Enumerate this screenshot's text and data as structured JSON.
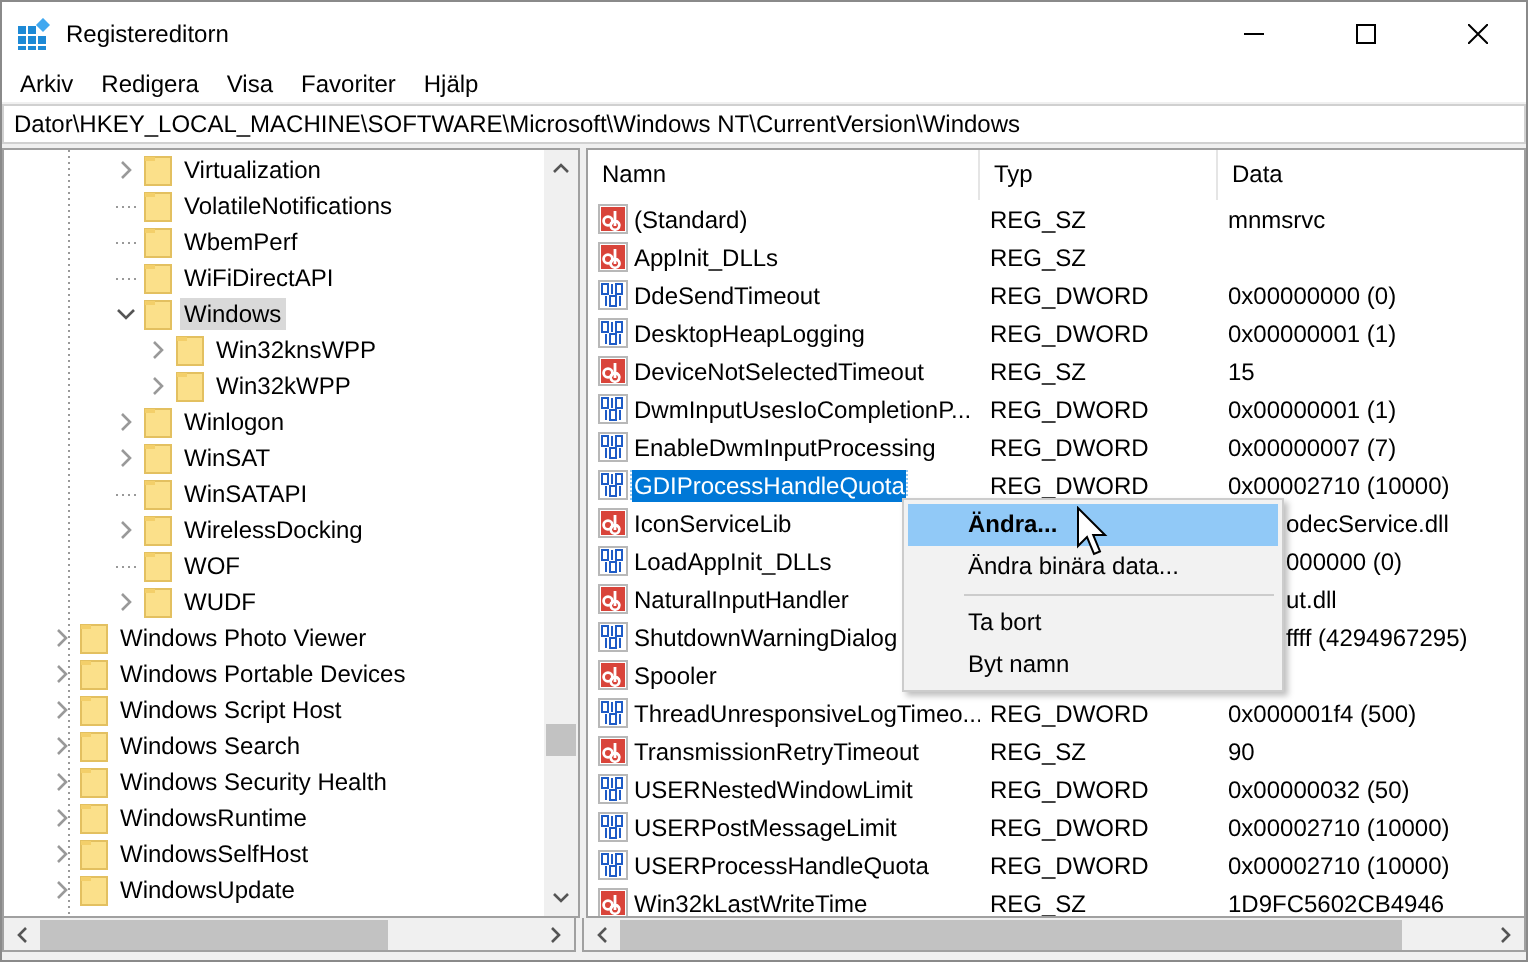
{
  "window": {
    "title": "Registereditorn"
  },
  "menu_bar": [
    "Arkiv",
    "Redigera",
    "Visa",
    "Favoriter",
    "Hjälp"
  ],
  "address": "Dator\\HKEY_LOCAL_MACHINE\\SOFTWARE\\Microsoft\\Windows NT\\CurrentVersion\\Windows",
  "tree": {
    "items": [
      {
        "children": [
          {
            "children": [
              {
                "label": "Virtualization",
                "expanded": false,
                "selected": false
              },
              {
                "label": "VolatileNotifications",
                "selected": false
              },
              {
                "label": "WbemPerf",
                "selected": false
              },
              {
                "label": "WiFiDirectAPI",
                "selected": false
              },
              {
                "label": "Windows",
                "expanded": true,
                "selected": true,
                "children": [
                  {
                    "label": "Win32knsWPP",
                    "expanded": false,
                    "selected": false
                  },
                  {
                    "label": "Win32kWPP",
                    "expanded": false,
                    "selected": false
                  }
                ]
              },
              {
                "label": "Winlogon",
                "expanded": false,
                "selected": false
              },
              {
                "label": "WinSAT",
                "expanded": false,
                "selected": false
              },
              {
                "label": "WinSATAPI",
                "selected": false
              },
              {
                "label": "WirelessDocking",
                "expanded": false,
                "selected": false
              },
              {
                "label": "WOF",
                "selected": false
              },
              {
                "label": "WUDF",
                "expanded": false,
                "selected": false
              }
            ]
          }
        ]
      },
      {
        "label": "Windows Photo Viewer",
        "expanded": false,
        "selected": false
      },
      {
        "label": "Windows Portable Devices",
        "expanded": false,
        "selected": false
      },
      {
        "label": "Windows Script Host",
        "expanded": false,
        "selected": false
      },
      {
        "label": "Windows Search",
        "expanded": false,
        "selected": false
      },
      {
        "label": "Windows Security Health",
        "expanded": false,
        "selected": false
      },
      {
        "label": "WindowsRuntime",
        "expanded": false,
        "selected": false
      },
      {
        "label": "WindowsSelfHost",
        "expanded": false,
        "selected": false
      },
      {
        "label": "WindowsUpdate",
        "expanded": false,
        "selected": false
      }
    ]
  },
  "table": {
    "columns": [
      "Namn",
      "Typ",
      "Data"
    ],
    "rows": [
      {
        "kind": "string",
        "name": "(Standard)",
        "type": "REG_SZ",
        "data": "mnmsrvc",
        "selected": false
      },
      {
        "kind": "string",
        "name": "AppInit_DLLs",
        "type": "REG_SZ",
        "selected": false
      },
      {
        "kind": "dword",
        "name": "DdeSendTimeout",
        "type": "REG_DWORD",
        "data": "0x00000000 (0)",
        "selected": false
      },
      {
        "kind": "dword",
        "name": "DesktopHeapLogging",
        "type": "REG_DWORD",
        "data": "0x00000001 (1)",
        "selected": false
      },
      {
        "kind": "string",
        "name": "DeviceNotSelectedTimeout",
        "type": "REG_SZ",
        "data": "15",
        "selected": false
      },
      {
        "kind": "dword",
        "name": "DwmInputUsesIoCompletionP...",
        "type": "REG_DWORD",
        "data": "0x00000001 (1)",
        "selected": false
      },
      {
        "kind": "dword",
        "name": "EnableDwmInputProcessing",
        "type": "REG_DWORD",
        "data": "0x00000007 (7)",
        "selected": false
      },
      {
        "kind": "dword",
        "name": "GDIProcessHandleQuota",
        "type": "REG_DWORD",
        "data": "0x00002710 (10000)",
        "selected": true
      },
      {
        "kind": "string",
        "name": "IconServiceLib",
        "data": "odecService.dll",
        "selected": false
      },
      {
        "kind": "dword",
        "name": "LoadAppInit_DLLs",
        "data": "000000 (0)",
        "selected": false
      },
      {
        "kind": "string",
        "name": "NaturalInputHandler",
        "data": "ut.dll",
        "selected": false
      },
      {
        "kind": "dword",
        "name": "ShutdownWarningDialog",
        "data": "ffff (4294967295)",
        "selected": false
      },
      {
        "kind": "string",
        "name": "Spooler",
        "selected": false
      },
      {
        "kind": "dword",
        "name": "ThreadUnresponsiveLogTimeo...",
        "type": "REG_DWORD",
        "data": "0x000001f4 (500)",
        "selected": false
      },
      {
        "kind": "string",
        "name": "TransmissionRetryTimeout",
        "type": "REG_SZ",
        "data": "90",
        "selected": false
      },
      {
        "kind": "dword",
        "name": "USERNestedWindowLimit",
        "type": "REG_DWORD",
        "data": "0x00000032 (50)",
        "selected": false
      },
      {
        "kind": "dword",
        "name": "USERPostMessageLimit",
        "type": "REG_DWORD",
        "data": "0x00002710 (10000)",
        "selected": false
      },
      {
        "kind": "dword",
        "name": "USERProcessHandleQuota",
        "type": "REG_DWORD",
        "data": "0x00002710 (10000)",
        "selected": false
      },
      {
        "kind": "string",
        "name": "Win32kLastWriteTime",
        "type": "REG_SZ",
        "data": "1D9FC5602CB4946",
        "selected": false
      }
    ]
  },
  "context_menu": {
    "items": [
      {
        "kind": "item",
        "label": "Ändra...",
        "default": true,
        "selected": true
      },
      {
        "kind": "item",
        "label": "Ändra binära data...",
        "default": false,
        "selected": false
      },
      {
        "kind": "separator"
      },
      {
        "kind": "item",
        "label": "Ta bort",
        "default": false,
        "selected": false
      },
      {
        "kind": "item",
        "label": "Byt namn",
        "default": false,
        "selected": false
      }
    ]
  }
}
